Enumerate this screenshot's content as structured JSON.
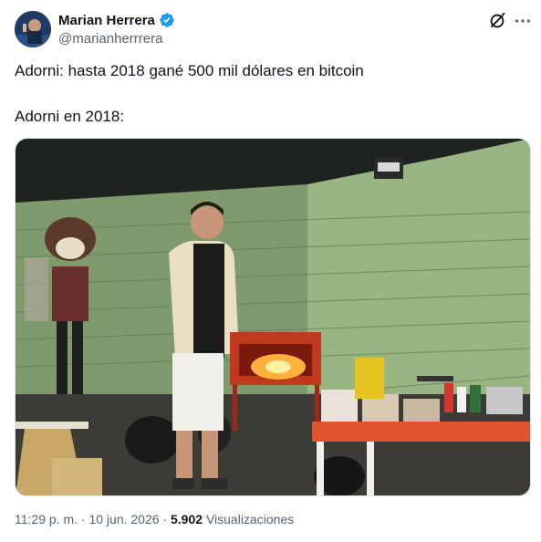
{
  "author": {
    "name": "Marian Herrera",
    "handle": "@marianherrrera"
  },
  "tweet": {
    "line1": "Adorni: hasta 2018 gané 500 mil dólares en bitcoin",
    "line2": "Adorni en 2018:"
  },
  "meta": {
    "time": "11:29 p. m.",
    "separator": "·",
    "date": "10 jun. 2026",
    "views_count": "5.902",
    "views_label": "Visualizaciones"
  },
  "icons": {
    "verified": "verified-badge-icon",
    "grok": "grok-icon",
    "more": "more-icon"
  },
  "colors": {
    "verified": "#1d9bf0",
    "secondary_text": "#536471",
    "primary_text": "#0f1419"
  }
}
